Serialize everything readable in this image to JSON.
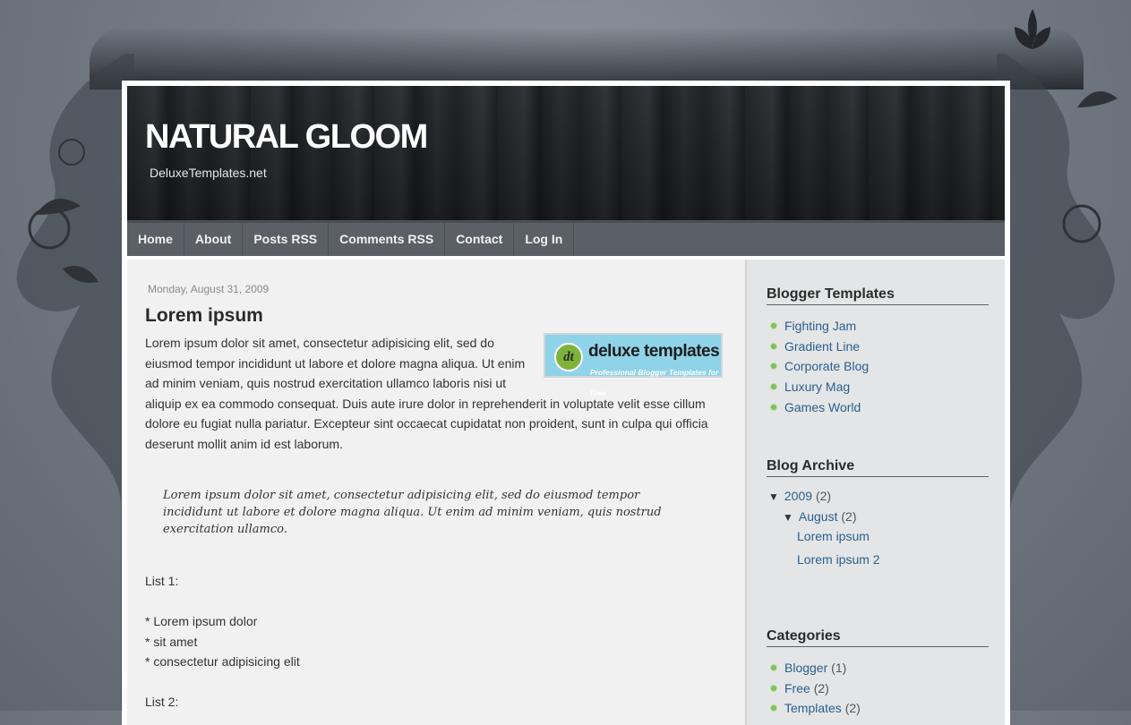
{
  "site": {
    "title": "NATURAL GLOOM",
    "description": "DeluxeTemplates.net"
  },
  "nav": {
    "items": [
      "Home",
      "About",
      "Posts RSS",
      "Comments RSS",
      "Contact",
      "Log In"
    ]
  },
  "post": {
    "date": "Monday, August 31, 2009",
    "title": "Lorem ipsum",
    "body": "Lorem ipsum dolor sit amet, consectetur adipisicing elit, sed do eiusmod tempor incididunt ut labore et dolore magna aliqua. Ut enim ad minim veniam, quis nostrud exercitation ullamco laboris nisi ut aliquip ex ea commodo consequat. Duis aute irure dolor in reprehenderit in voluptate velit esse cillum dolore eu fugiat nulla pariatur. Excepteur sint occaecat cupidatat non proident, sunt in culpa qui officia deserunt mollit anim id est laborum.",
    "image": {
      "logo": "dt",
      "brand": "deluxe templates",
      "tagline": "Professional Blogger Templates for Free"
    },
    "quote": "Lorem ipsum dolor sit amet, consectetur adipisicing elit, sed do eiusmod tempor incididunt ut labore et dolore magna aliqua. Ut enim ad minim veniam, quis nostrud exercitation ullamco.",
    "list1_label": "List 1:",
    "list1_items": [
      "* Lorem ipsum dolor",
      "* sit amet",
      "* consectetur adipisicing elit"
    ],
    "list2_label": "List 2:"
  },
  "sidebar": {
    "templates": {
      "title": "Blogger Templates",
      "items": [
        "Fighting Jam",
        "Gradient Line",
        "Corporate Blog",
        "Luxury Mag",
        "Games World"
      ]
    },
    "archive": {
      "title": "Blog Archive",
      "year": "2009",
      "year_count": "(2)",
      "month": "August",
      "month_count": "(2)",
      "posts": [
        "Lorem ipsum",
        "Lorem ipsum 2"
      ],
      "toggle": "▼"
    },
    "categories": {
      "title": "Categories",
      "items": [
        {
          "label": "Blogger",
          "count": "(1)"
        },
        {
          "label": "Free",
          "count": "(2)"
        },
        {
          "label": "Templates",
          "count": "(2)"
        }
      ]
    }
  },
  "colors": {
    "nav_bg": "#5b6066",
    "link": "#2a5f8f",
    "bullet": "#7fc05a"
  }
}
